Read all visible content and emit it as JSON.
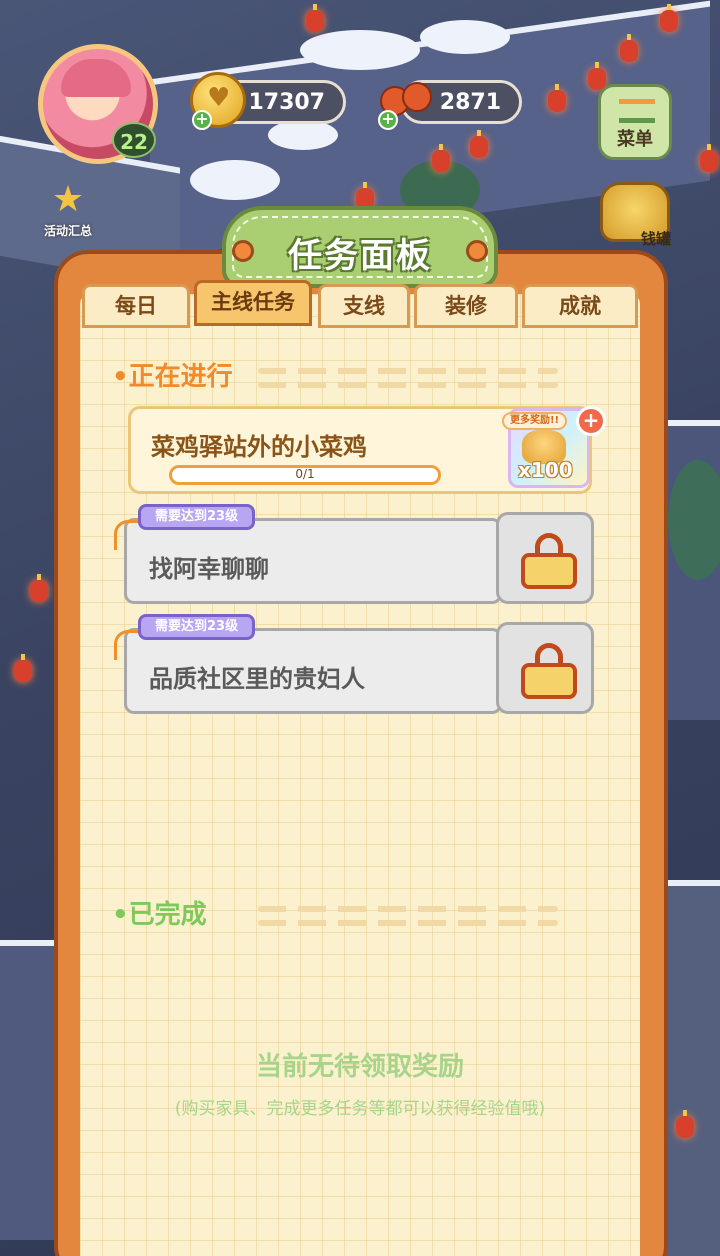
{
  "hud": {
    "level": "22",
    "coins": "17307",
    "vegetables": "2871",
    "menu_label": "菜单",
    "activity_label": "活动汇总",
    "right_button_label": "钱罐"
  },
  "panel": {
    "title": "任务面板",
    "tabs": [
      {
        "label": "每日",
        "active": false
      },
      {
        "label": "主线任务",
        "active": true
      },
      {
        "label": "支线",
        "active": false
      },
      {
        "label": "装修",
        "active": false
      },
      {
        "label": "成就",
        "active": false
      }
    ],
    "ongoing_heading": "正在进行",
    "active_quest": {
      "title": "菜鸡驿站外的小菜鸡",
      "progress_text": "0/1",
      "progress_fraction": 0,
      "reward_tag": "更多奖励!!",
      "reward_count": "x100",
      "reward_icon": "golden-chick-icon"
    },
    "locked_quests": [
      {
        "requirement": "需要达到23级",
        "title": "找阿幸聊聊"
      },
      {
        "requirement": "需要达到23级",
        "title": "品质社区里的贵妇人"
      }
    ],
    "completed_heading": "已完成",
    "empty_message": "当前无待领取奖励",
    "empty_hint": "(购买家具、完成更多任务等都可以获得经验值哦)"
  },
  "colors": {
    "panel_frame": "#e3863e",
    "paper": "#fbf1cf",
    "ongoing_heading": "#f08a2a",
    "completed_heading": "#7fc85a",
    "locked_tag": "#b9a6f3"
  }
}
